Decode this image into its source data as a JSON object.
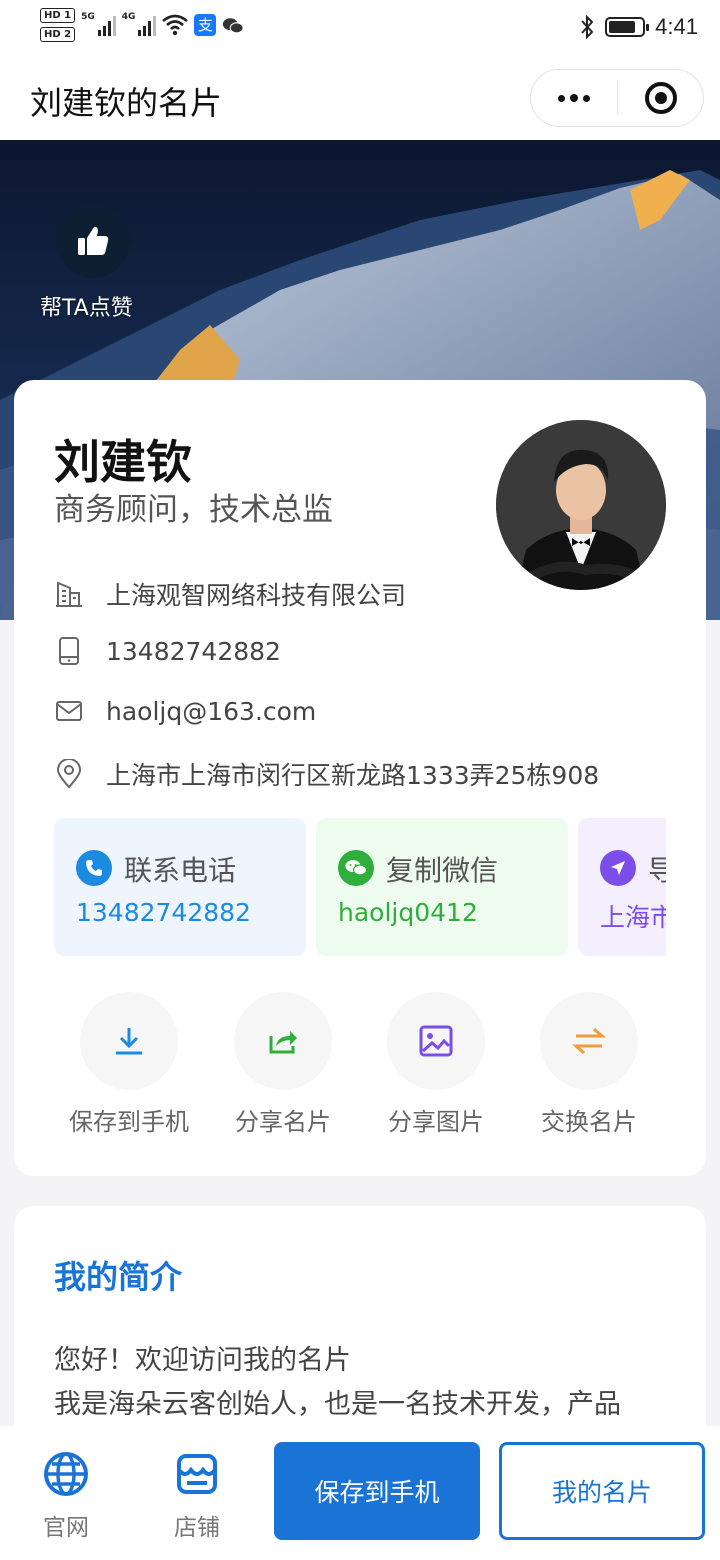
{
  "status_bar": {
    "hd1": "HD 1",
    "hd2": "HD 2",
    "net1": "5G",
    "net2": "4G",
    "time": "4:41",
    "battery_level": 0.8,
    "icons": [
      "signal-icon",
      "wifi-icon",
      "alipay-icon",
      "wechat-icon",
      "bluetooth-icon",
      "battery-icon"
    ]
  },
  "title_bar": {
    "title": "刘建钦的名片"
  },
  "hero": {
    "like_label": "帮TA点赞"
  },
  "profile": {
    "name": "刘建钦",
    "role": "商务顾问，技术总监",
    "company": "上海观智网络科技有限公司",
    "phone": "13482742882",
    "email": "haoljq@163.com",
    "address": "上海市上海市闵行区新龙路1333弄25栋908"
  },
  "quick_actions": [
    {
      "title": "联系电话",
      "value": "13482742882",
      "icon": "phone-icon",
      "color": "#1a8be0",
      "bg": "#eef5ff"
    },
    {
      "title": "复制微信",
      "value": "haoljq0412",
      "icon": "wechat-icon",
      "color": "#2fae3b",
      "bg": "#eefbef"
    },
    {
      "title": "导",
      "value": "上海市",
      "icon": "navigation-icon",
      "color": "#7c4de8",
      "bg": "#f3efff"
    }
  ],
  "tools": [
    {
      "label": "保存到手机",
      "icon": "download-icon",
      "color": "#1a8be0"
    },
    {
      "label": "分享名片",
      "icon": "share-icon",
      "color": "#2fae3b"
    },
    {
      "label": "分享图片",
      "icon": "image-icon",
      "color": "#7c4de8"
    },
    {
      "label": "交换名片",
      "icon": "exchange-icon",
      "color": "#f29b38"
    }
  ],
  "intro": {
    "title": "我的简介",
    "line1": "您好！欢迎访问我的名片",
    "line2": "我是海朵云客创始人，也是一名技术开发，产品"
  },
  "bottom_bar": {
    "website": "官网",
    "store": "店铺",
    "save_button": "保存到手机",
    "my_card_button": "我的名片",
    "accent": "#1a74d6"
  }
}
